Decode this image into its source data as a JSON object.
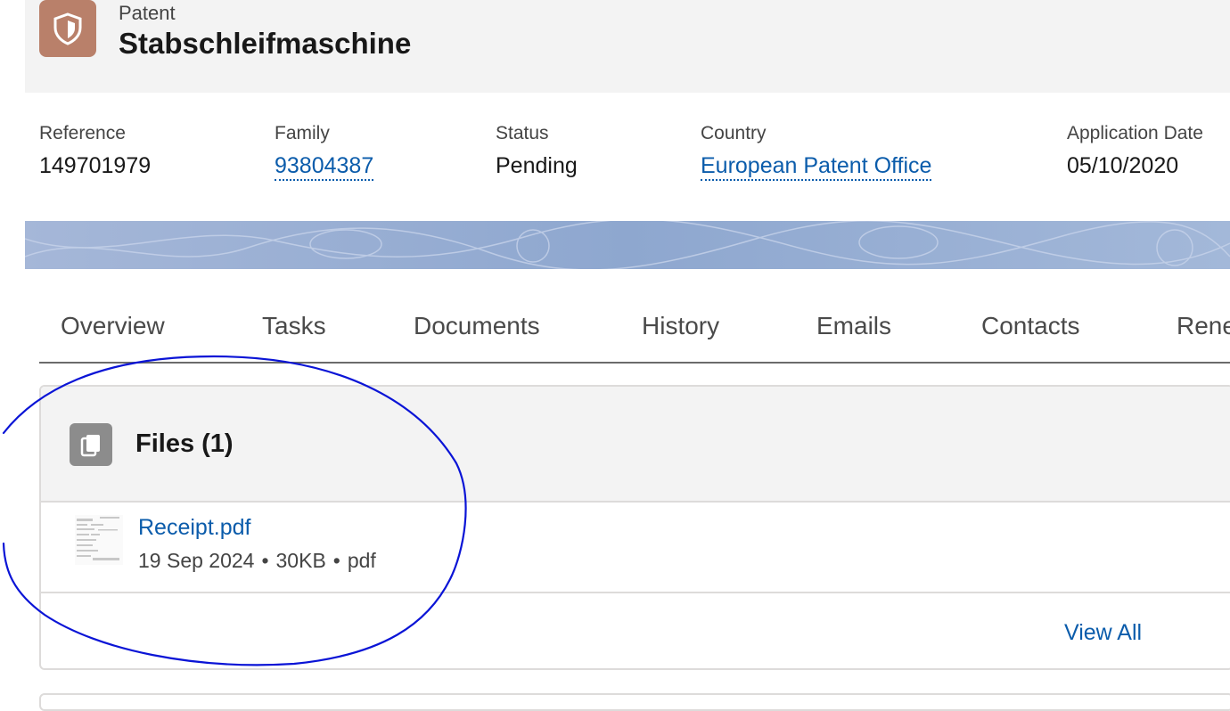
{
  "header": {
    "record_type": "Patent",
    "record_title": "Stabschleifmaschine",
    "icon": "patent-shield-icon",
    "icon_color": "#b9806a"
  },
  "fields": [
    {
      "label": "Reference",
      "value": "149701979",
      "is_link": false
    },
    {
      "label": "Family",
      "value": "93804387",
      "is_link": true
    },
    {
      "label": "Status",
      "value": "Pending",
      "is_link": false
    },
    {
      "label": "Country",
      "value": "European Patent Office",
      "is_link": true
    },
    {
      "label": "Application Date",
      "value": "05/10/2020",
      "is_link": false
    }
  ],
  "tabs": [
    {
      "label": "Overview"
    },
    {
      "label": "Tasks"
    },
    {
      "label": "Documents"
    },
    {
      "label": "History"
    },
    {
      "label": "Emails"
    },
    {
      "label": "Contacts"
    },
    {
      "label": "Rene"
    }
  ],
  "files_card": {
    "title": "Files (1)",
    "icon": "files-icon",
    "files": [
      {
        "name": "Receipt.pdf",
        "date": "19 Sep 2024",
        "size": "30KB",
        "type": "pdf"
      }
    ],
    "separator": "•",
    "view_all": "View All"
  },
  "annotation": {
    "color": "#0a14d6",
    "shape": "hand-drawn-circle"
  },
  "colors": {
    "link": "#0b5cab",
    "header_bg": "#f3f3f3",
    "border": "#dddbda"
  }
}
